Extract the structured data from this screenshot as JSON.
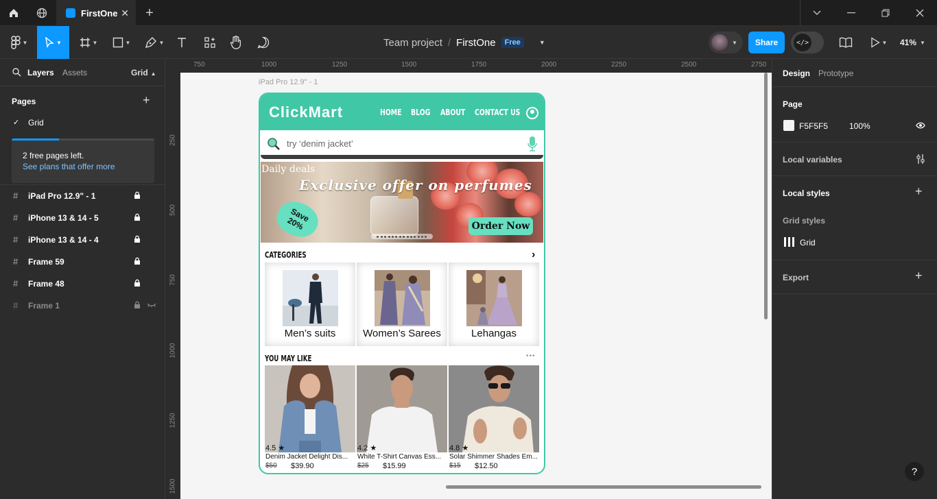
{
  "titlebar": {
    "tab_title": "FirstOne",
    "new_tab": "+",
    "close": "✕"
  },
  "toolbar": {
    "breadcrumb_team": "Team project",
    "breadcrumb_sep": "/",
    "breadcrumb_file": "FirstOne",
    "plan_badge": "Free",
    "share_label": "Share",
    "devmode_label": "</>",
    "zoom": "41%"
  },
  "left_panel": {
    "tab_layers": "Layers",
    "tab_assets": "Assets",
    "page_selector": "Grid",
    "pages_heading": "Pages",
    "current_page": "Grid",
    "free_pages_text": "2 free pages left.",
    "free_pages_link": "See plans that offer more",
    "free_pages_used_fraction": 0.33,
    "layers": [
      {
        "name": "iPad Pro 12.9\" - 1",
        "locked": true,
        "hidden": false
      },
      {
        "name": "iPhone 13 & 14 - 5",
        "locked": true,
        "hidden": false
      },
      {
        "name": "iPhone 13 & 14 - 4",
        "locked": true,
        "hidden": false
      },
      {
        "name": "Frame 59",
        "locked": true,
        "hidden": false
      },
      {
        "name": "Frame 48",
        "locked": true,
        "hidden": false
      },
      {
        "name": "Frame 1",
        "locked": true,
        "hidden": true
      }
    ]
  },
  "canvas": {
    "ruler_x": [
      "750",
      "1000",
      "1250",
      "1500",
      "1750",
      "2000",
      "2250",
      "2500",
      "2750"
    ],
    "ruler_y": [
      "250",
      "500",
      "750",
      "1000",
      "1250",
      "1500"
    ],
    "frame_label": "iPad Pro 12.9\" - 1",
    "frame_accent": "#40c7a6"
  },
  "design": {
    "logo": "ClickMart",
    "nav": [
      "HOME",
      "BLOG",
      "ABOUT",
      "CONTACT US"
    ],
    "search_placeholder": "try ‘denim jacket’",
    "banner": {
      "daily": "Daily deals",
      "title": "Exclusive offer on perfumes",
      "save_line1": "Save",
      "save_line2": "20%",
      "cta": "Order Now"
    },
    "categories_title": "CATEGORIES",
    "categories": [
      "Men’s suits",
      "Women’s Sarees",
      "Lehangas"
    ],
    "you_may_like_title": "YOU MAY LIKE",
    "products": [
      {
        "rating": "4.5 ★",
        "name": "Denim Jacket Delight Dis...",
        "old_price": "$50",
        "price": "$39.90"
      },
      {
        "rating": "4.2 ★",
        "name": "White T-Shirt Canvas Ess...",
        "old_price": "$25",
        "price": "$15.99"
      },
      {
        "rating": "4.8 ★",
        "name": "Solar Shimmer Shades Em...",
        "old_price": "$15",
        "price": "$12.50"
      }
    ]
  },
  "right_panel": {
    "tab_design": "Design",
    "tab_prototype": "Prototype",
    "page_heading": "Page",
    "page_color": "F5F5F5",
    "page_opacity": "100%",
    "local_variables": "Local variables",
    "local_styles": "Local styles",
    "grid_styles": "Grid styles",
    "grid_style_name": "Grid",
    "export": "Export"
  },
  "help": "?"
}
